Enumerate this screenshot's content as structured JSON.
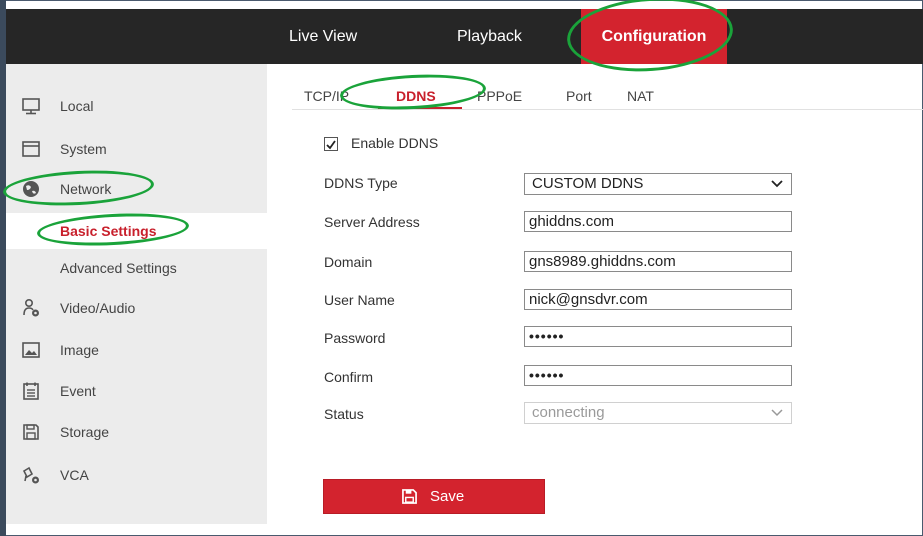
{
  "top_nav": {
    "live_view": "Live View",
    "playback": "Playback",
    "configuration": "Configuration"
  },
  "sidebar": {
    "items": [
      {
        "label": "Local",
        "icon": "monitor-icon"
      },
      {
        "label": "System",
        "icon": "window-icon"
      },
      {
        "label": "Network",
        "icon": "globe-icon"
      },
      {
        "label": "Basic Settings",
        "active": true
      },
      {
        "label": "Advanced Settings"
      },
      {
        "label": "Video/Audio",
        "icon": "person-settings-icon"
      },
      {
        "label": "Image",
        "icon": "image-icon"
      },
      {
        "label": "Event",
        "icon": "calendar-icon"
      },
      {
        "label": "Storage",
        "icon": "floppy-icon"
      },
      {
        "label": "VCA",
        "icon": "vca-icon"
      }
    ]
  },
  "tabs": [
    {
      "label": "TCP/IP"
    },
    {
      "label": "DDNS",
      "active": true
    },
    {
      "label": "PPPoE"
    },
    {
      "label": "Port"
    },
    {
      "label": "NAT"
    }
  ],
  "form": {
    "enable_ddns": {
      "label": "Enable DDNS",
      "checked": true
    },
    "ddns_type": {
      "label": "DDNS Type",
      "value": "CUSTOM DDNS"
    },
    "server_address": {
      "label": "Server Address",
      "value": "ghiddns.com"
    },
    "domain": {
      "label": "Domain",
      "value": "gns8989.ghiddns.com"
    },
    "user_name": {
      "label": "User Name",
      "value": "nick@gnsdvr.com"
    },
    "password": {
      "label": "Password",
      "value": "••••••"
    },
    "confirm": {
      "label": "Confirm",
      "value": "••••••"
    },
    "status": {
      "label": "Status",
      "value": "connecting"
    }
  },
  "save_button": {
    "label": "Save"
  },
  "colors": {
    "accent_red": "#d3232e",
    "nav_bg": "#262626",
    "sidebar_bg": "#ececec",
    "annotation_green": "#1aa33a"
  }
}
